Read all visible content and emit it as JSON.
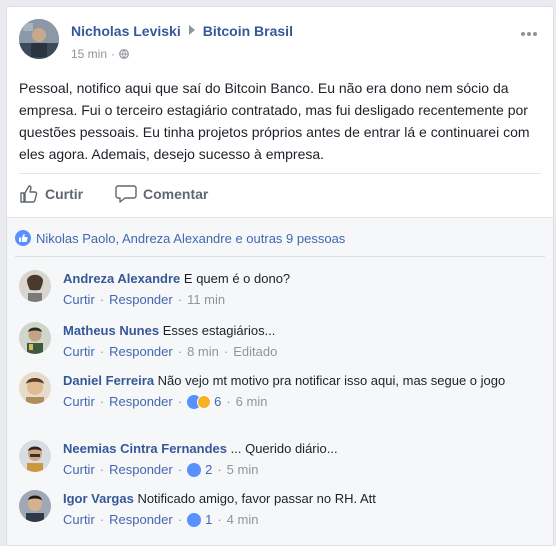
{
  "post": {
    "author": "Nicholas Leviski",
    "group": "Bitcoin Brasil",
    "time": "15 min",
    "dot": "·",
    "text": "Pessoal, notifico aqui que saí do Bitcoin Banco. Eu não era dono nem sócio da empresa. Fui o terceiro estagiário contratado, mas fui desligado recentemente por questões pessoais. Eu tinha projetos próprios antes de entrar lá e continuarei com eles agora. Ademais, desejo sucesso à empresa."
  },
  "actions": {
    "like": "Curtir",
    "comment": "Comentar"
  },
  "likes_summary": "Nikolas Paolo, Andreza Alexandre e outras 9 pessoas",
  "comment_links": {
    "like": "Curtir",
    "reply": "Responder"
  },
  "comments": [
    {
      "author": "Andreza Alexandre",
      "text": "E quem é o dono?",
      "time": "11 min",
      "reactions": "",
      "edited": ""
    },
    {
      "author": "Matheus Nunes",
      "text": "Esses estagiários...",
      "time": "8 min",
      "reactions": "",
      "edited": "Editado"
    },
    {
      "author": "Daniel Ferreira",
      "text": "Não vejo mt motivo pra notificar isso aqui, mas segue o jogo",
      "time": "6 min",
      "reactions": "6",
      "edited": ""
    },
    {
      "author": "Neemias Cintra Fernandes",
      "text": "... Querido diário...",
      "time": "5 min",
      "reactions": "2",
      "edited": ""
    },
    {
      "author": "Igor Vargas",
      "text": "Notificado amigo, favor passar no RH. Att",
      "time": "4 min",
      "reactions": "1",
      "edited": ""
    }
  ],
  "colors": {
    "link": "#365899",
    "accent": "#4267b2",
    "meta": "#90949c",
    "like_blue": "#5890ff",
    "haha_yellow": "#f7b125"
  },
  "icons": {
    "like": "thumbs-up-icon",
    "comment": "speech-bubble-icon",
    "privacy": "globe-icon",
    "menu": "more-dots-icon"
  }
}
